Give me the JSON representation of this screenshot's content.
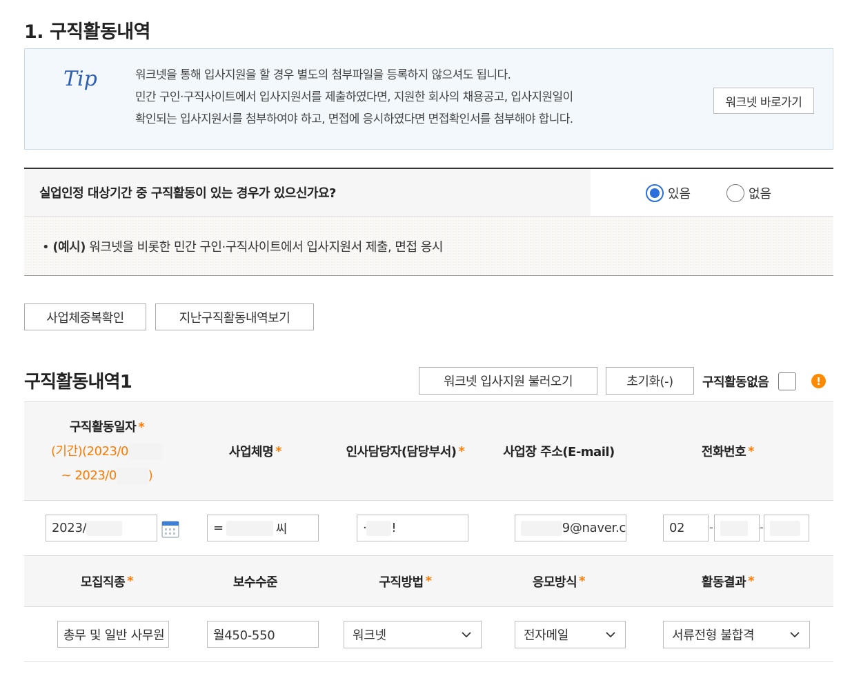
{
  "section_title": "1. 구직활동내역",
  "tip": {
    "logo": "Tip",
    "lines": [
      "워크넷을 통해 입사지원을 할 경우 별도의 첨부파일을 등록하지 않으셔도 됩니다.",
      "민간 구인·구직사이트에서 입사지원서를 제출하였다면, 지원한 회사의 채용공고, 입사지원일이",
      "확인되는 입사지원서를 첨부하여야 하고, 면접에 응시하였다면 면접확인서를 첨부해야 합니다."
    ],
    "button_label": "워크넷 바로가기"
  },
  "question": {
    "label": "실업인정 대상기간 중 구직활동이 있는 경우가 있으신가요?",
    "options": [
      {
        "label": "있음",
        "selected": true
      },
      {
        "label": "없음",
        "selected": false
      }
    ]
  },
  "example": {
    "bullet": "•",
    "prefix": "(예시)",
    "text": " 워크넷을 비롯한 민간 구인·구직사이트에서 입사지원서 제출, 면접 응시"
  },
  "buttons": {
    "dup_check": "사업체중복확인",
    "past_history": "지난구직활동내역보기"
  },
  "activity": {
    "title": "구직활동내역1",
    "load_button": "워크넷 입사지원 불러오기",
    "reset_button": "초기화(-)",
    "none_label": "구직활동없음",
    "alert_icon_symbol": "!",
    "headers1": {
      "date": "구직활동일자",
      "period_start": "(기간)(2023/0",
      "period_end_prefix": "~ 2023/0",
      "period_end_suffix": ")",
      "company": "사업체명",
      "hr": "인사담당자(담당부서)",
      "email": "사업장 주소(E-mail)",
      "phone": "전화번호"
    },
    "required_mark": "*",
    "values1": {
      "date": "2023/",
      "company_prefix": "=",
      "company_suffix": "씨",
      "hr_prefix": "·",
      "hr_suffix": "!",
      "email_suffix": "9@naver.c",
      "phone_area": "02",
      "phone_dash": "-"
    },
    "headers2": {
      "job": "모집직종",
      "salary": "보수수준",
      "method": "구직방법",
      "apply": "응모방식",
      "result": "활동결과"
    },
    "values2": {
      "job": "총무 및 일반 사무원",
      "salary": "월450-550",
      "method": "워크넷",
      "apply": "전자메일",
      "result": "서류전형 불합격"
    }
  },
  "colors": {
    "accent_blue": "#2a6fdb",
    "required_orange": "#ff7a00",
    "tip_bg": "#f2f8fc"
  }
}
